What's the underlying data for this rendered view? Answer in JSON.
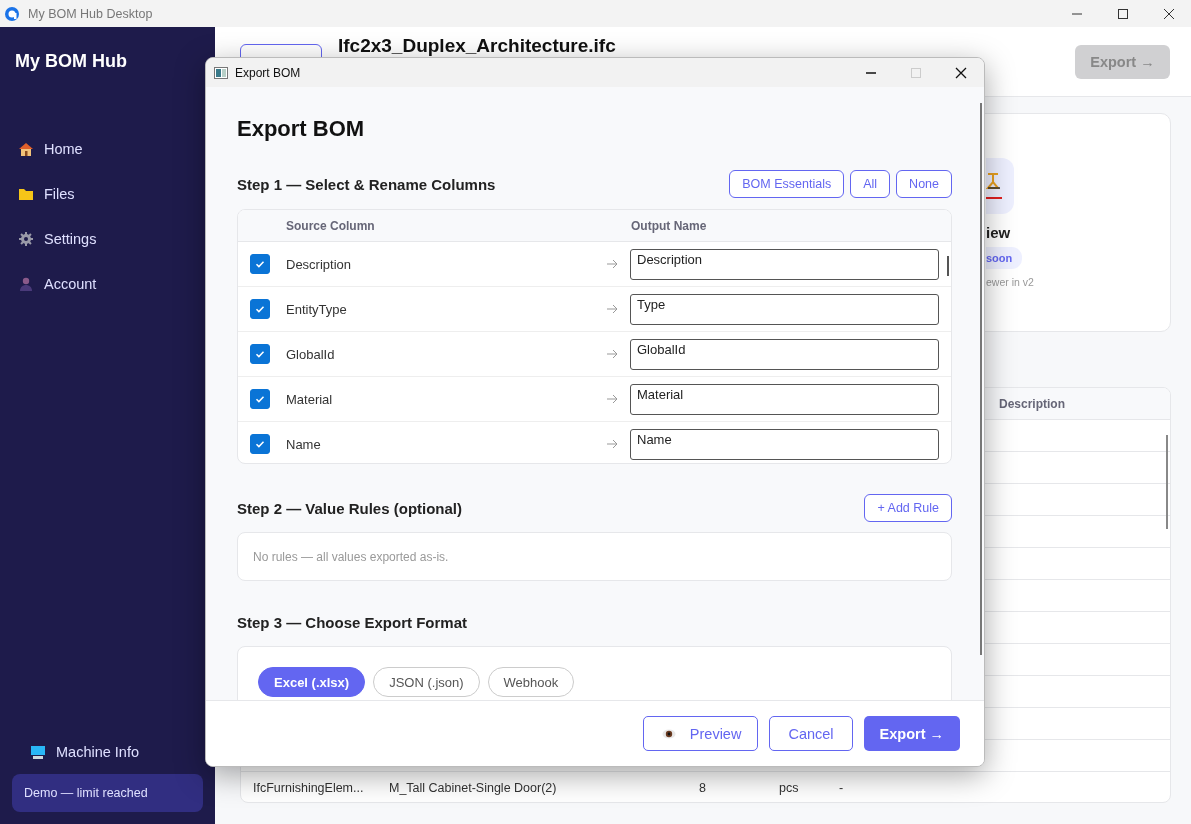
{
  "app_window": {
    "title": "My BOM Hub Desktop"
  },
  "sidebar": {
    "brand": "My BOM Hub",
    "items": [
      {
        "label": "Home"
      },
      {
        "label": "Files"
      },
      {
        "label": "Settings"
      },
      {
        "label": "Account"
      }
    ],
    "machine_info": "Machine Info",
    "demo_status": "Demo — limit reached"
  },
  "header": {
    "title": "Ifc2x3_Duplex_Architecture.ifc",
    "export_button": {
      "label": "Export →",
      "disabled": true
    }
  },
  "viewer_card": {
    "title": "iew",
    "badge": "soon",
    "caption": "ewer in v2"
  },
  "table": {
    "visible_heading": "Description",
    "last_row": [
      "IfcFurnishingElem...",
      "M_Tall Cabinet-Single Door(2)",
      "8",
      "pcs",
      "-"
    ]
  },
  "dialog": {
    "title": "Export BOM",
    "heading": "Export BOM",
    "step1": {
      "heading": "Step 1 — Select & Rename Columns",
      "presets": [
        "BOM Essentials",
        "All",
        "None"
      ],
      "columns": [
        "Source Column",
        "Output Name"
      ],
      "rows": [
        {
          "source": "Description",
          "output": "Description",
          "checked": true
        },
        {
          "source": "EntityType",
          "output": "Type",
          "checked": true
        },
        {
          "source": "GlobalId",
          "output": "GlobalId",
          "checked": true
        },
        {
          "source": "Material",
          "output": "Material",
          "checked": true
        },
        {
          "source": "Name",
          "output": "Name",
          "checked": true
        }
      ]
    },
    "step2": {
      "heading": "Step 2 — Value Rules (optional)",
      "add_button": "+ Add Rule",
      "empty_text": "No rules — all values exported as-is."
    },
    "step3": {
      "heading": "Step 3 — Choose Export Format",
      "formats": [
        {
          "label": "Excel (.xlsx)",
          "selected": true
        },
        {
          "label": "JSON (.json)",
          "selected": false
        },
        {
          "label": "Webhook",
          "selected": false
        }
      ]
    },
    "buttons": {
      "preview": "Preview",
      "cancel": "Cancel",
      "export": "Export →"
    }
  }
}
